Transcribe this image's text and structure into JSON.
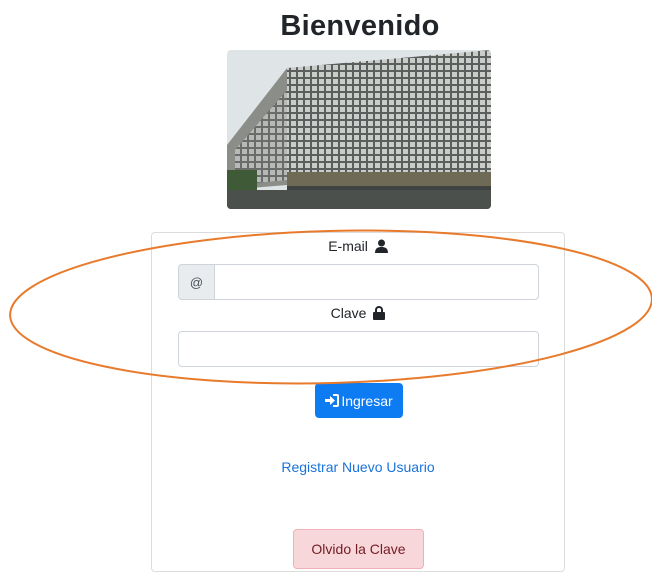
{
  "header": {
    "title": "Bienvenido"
  },
  "form": {
    "email_label": "E-mail",
    "email_prefix": "@",
    "email_value": "",
    "password_label": "Clave",
    "password_value": "",
    "login_button": "Ingresar",
    "register_link": "Registrar Nuevo Usuario",
    "forgot_button": "Olvido la Clave"
  },
  "icons": {
    "email_label_icon": "user-icon",
    "password_label_icon": "lock-icon",
    "login_button_icon": "sign-in-icon"
  },
  "colors": {
    "primary": "#0d7cf2",
    "link": "#1a73d9",
    "danger_bg": "#f8d7da",
    "danger_text": "#721c24",
    "annotation": "#e87a2c"
  }
}
